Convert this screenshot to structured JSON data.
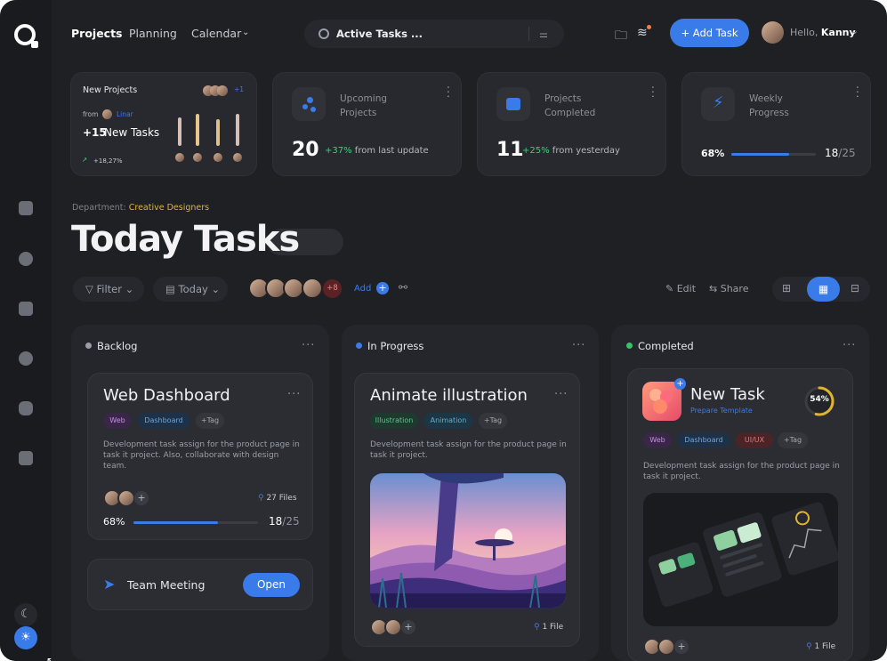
{
  "header": {
    "nav": [
      "Projects",
      "Planning",
      "Calendar"
    ],
    "search_value": "Active Tasks ...",
    "add_task": "+ Add Task",
    "greeting": "Hello,",
    "user_name": "Kanny"
  },
  "stats": {
    "new_projects": {
      "title": "New Projects",
      "more": "+1",
      "from_label": "from",
      "from_user": "Linar",
      "tasks": "+15",
      "tasks_label": "New Tasks",
      "growth": "+18,27%"
    },
    "upcoming": {
      "title_1": "Upcoming",
      "title_2": "Projects",
      "value": "20",
      "change": "+37%",
      "change_text": "from last update"
    },
    "completed": {
      "title_1": "Projects",
      "title_2": "Completed",
      "value": "11",
      "change": "+25%",
      "change_text": "from yesterday"
    },
    "weekly": {
      "title_1": "Weekly",
      "title_2": "Progress",
      "percent": "68%",
      "count": "18",
      "total": "/25",
      "progress": 0.68
    }
  },
  "page": {
    "department_label": "Department:",
    "department": "Creative Designers",
    "title": "Today Tasks"
  },
  "toolbar": {
    "filter": "Filter",
    "today": "Today",
    "members_more": "+8",
    "add": "Add",
    "edit": "Edit",
    "share": "Share"
  },
  "columns": {
    "backlog": {
      "title": "Backlog",
      "color": "#9a9ea7",
      "card": {
        "title": "Web Dashboard",
        "tags": [
          "Web",
          "Dashboard",
          "+Tag"
        ],
        "desc_1": "Development task assign for the product page in",
        "desc_2": "task it project. Also, collaborate with design",
        "desc_3": "team.",
        "files": "27 Files",
        "percent": "68%",
        "count": "18",
        "total": "/25",
        "progress": 0.68
      },
      "meeting": {
        "title": "Team Meeting",
        "button": "Open"
      }
    },
    "progress": {
      "title": "In Progress",
      "color": "#3a7bea",
      "card": {
        "title": "Animate illustration",
        "tags": [
          "Illustration",
          "Animation",
          "+Tag"
        ],
        "desc_1": "Development task assign for the product page in",
        "desc_2": "task it project.",
        "files": "1 File"
      }
    },
    "completed": {
      "title": "Completed",
      "color": "#35c46a",
      "card": {
        "title": "New Task",
        "subtitle": "Prepare Template",
        "ring": "54%",
        "ring_value": 0.54,
        "tags": [
          "Web",
          "Dashboard",
          "UI/UX",
          "+Tag"
        ],
        "desc_1": "Development task assign for the product page in",
        "desc_2": "task it project.",
        "files": "1 File"
      }
    }
  }
}
